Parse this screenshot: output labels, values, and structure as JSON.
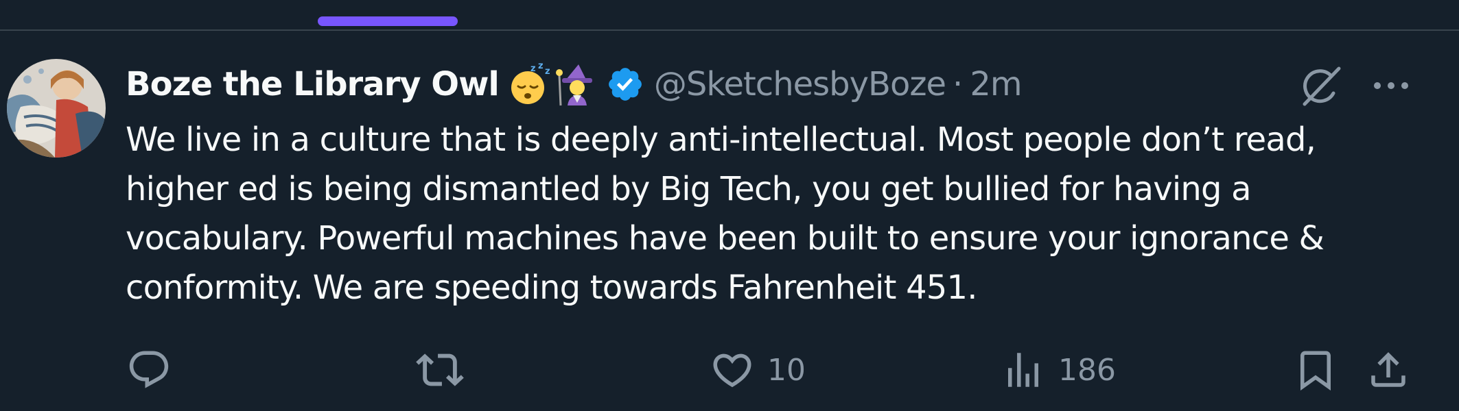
{
  "tweet": {
    "display_name": "Boze the Library Owl",
    "emoji": [
      "sleeping-face",
      "mage-woman"
    ],
    "verified": true,
    "handle": "@SketchesbyBoze",
    "separator": "·",
    "time": "2m",
    "text": "We live in a culture that is deeply anti-intellectual. Most people don’t read, higher ed is being dismantled by Big Tech, you get bullied for having a vocabulary. Powerful machines have been built to ensure your ignorance & conformity. We are speeding towards Fahrenheit 451."
  },
  "actions": {
    "reply_count": "",
    "retweet_count": "",
    "like_count": "10",
    "views_count": "186"
  },
  "icons": {
    "reply": "reply-icon",
    "retweet": "retweet-icon",
    "like": "heart-icon",
    "views": "views-icon",
    "bookmark": "bookmark-icon",
    "share": "share-icon",
    "grok": "grok-icon",
    "more": "more-icon"
  },
  "colors": {
    "background": "#15202b",
    "text": "#f7f9f9",
    "secondary": "#8b98a5",
    "accent": "#7856ff",
    "verified": "#1d9bf0",
    "divider": "#38444d"
  }
}
